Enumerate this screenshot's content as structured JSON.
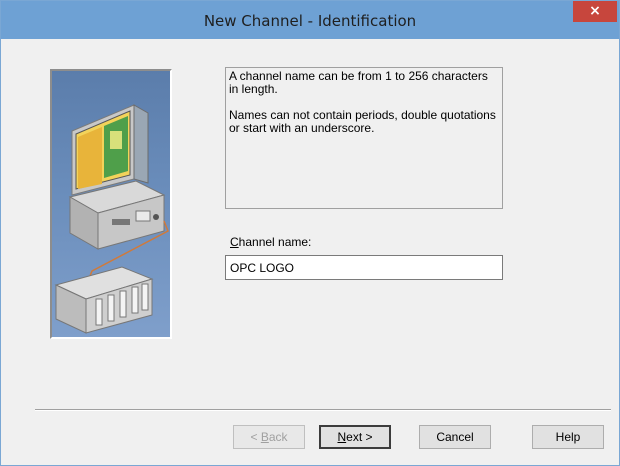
{
  "window": {
    "title": "New Channel - Identification",
    "close_glyph": "×"
  },
  "description": {
    "line1": "A channel name can be from 1 to 256 characters in length.",
    "line2": "Names can not contain periods, double quotations or start with an underscore."
  },
  "channel_name": {
    "label_mnemonic": "C",
    "label_rest": "hannel name:",
    "value": "OPC LOGO"
  },
  "buttons": {
    "back_prefix": "< ",
    "back_mnemonic": "B",
    "back_rest": "ack",
    "next_mnemonic": "N",
    "next_rest": "ext >",
    "cancel": "Cancel",
    "help": "Help"
  },
  "illustration": {
    "icon": "computer-to-plc-icon"
  },
  "colors": {
    "titlebar": "#6ea1d4",
    "close": "#c7463d",
    "dialog_bg": "#f0f0f0"
  }
}
